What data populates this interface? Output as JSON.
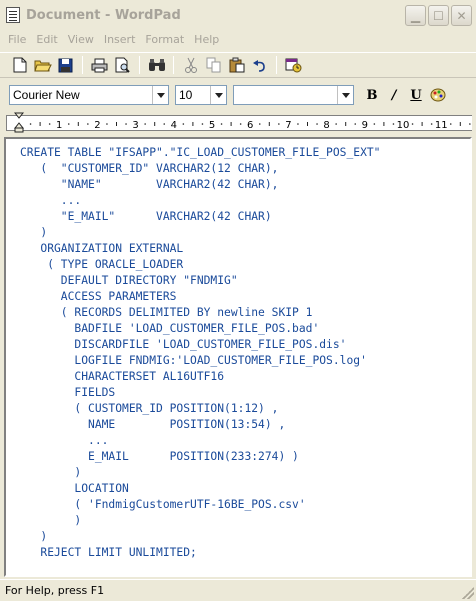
{
  "window": {
    "title": "Document - WordPad"
  },
  "menu": [
    "File",
    "Edit",
    "View",
    "Insert",
    "Format",
    "Help"
  ],
  "toolbar": {
    "buttons": [
      {
        "name": "new-document-icon",
        "glyph": "🗋"
      },
      {
        "name": "open-folder-icon",
        "glyph": "📂"
      },
      {
        "name": "save-icon",
        "glyph": "💾"
      },
      {
        "name": "print-icon",
        "glyph": "🖶"
      },
      {
        "name": "print-preview-icon",
        "glyph": "🔍"
      },
      {
        "name": "find-icon",
        "glyph": "🔭"
      },
      {
        "name": "cut-icon",
        "glyph": "✂"
      },
      {
        "name": "copy-icon",
        "glyph": "⎘"
      },
      {
        "name": "paste-icon",
        "glyph": "📋"
      },
      {
        "name": "undo-icon",
        "glyph": "↶"
      },
      {
        "name": "insert-datetime-icon",
        "glyph": "🗓"
      }
    ]
  },
  "format": {
    "font_name": "Courier New",
    "font_size": "10",
    "script": "",
    "bold": "B",
    "italic": "/",
    "underline": "U",
    "color_icon": "palette-icon"
  },
  "ruler": {
    "labels": [
      "1",
      "2",
      "3",
      "4",
      "5",
      "6",
      "7",
      "8",
      "9",
      "10",
      "11"
    ]
  },
  "document": {
    "lines": [
      "CREATE TABLE \"IFSAPP\".\"IC_LOAD_CUSTOMER_FILE_POS_EXT\"",
      "   (  \"CUSTOMER_ID\" VARCHAR2(12 CHAR),",
      "      \"NAME\"        VARCHAR2(42 CHAR),",
      "      ...",
      "      \"E_MAIL\"      VARCHAR2(42 CHAR)",
      "   )",
      "   ORGANIZATION EXTERNAL",
      "    ( TYPE ORACLE_LOADER",
      "      DEFAULT DIRECTORY \"FNDMIG\"",
      "      ACCESS PARAMETERS",
      "      ( RECORDS DELIMITED BY newline SKIP 1",
      "        BADFILE 'LOAD_CUSTOMER_FILE_POS.bad'",
      "        DISCARDFILE 'LOAD_CUSTOMER_FILE_POS.dis'",
      "        LOGFILE FNDMIG:'LOAD_CUSTOMER_FILE_POS.log'",
      "        CHARACTERSET AL16UTF16",
      "        FIELDS",
      "        ( CUSTOMER_ID POSITION(1:12) ,",
      "          NAME        POSITION(13:54) ,",
      "          ...",
      "          E_MAIL      POSITION(233:274) )",
      "        )",
      "        LOCATION",
      "        ( 'FndmigCustomerUTF-16BE_POS.csv'",
      "        )",
      "   )",
      "   REJECT LIMIT UNLIMITED;"
    ]
  },
  "status": {
    "text": "For Help, press F1"
  },
  "colors": {
    "code_text": "#1a4a9a",
    "chrome": "#ece9d8"
  }
}
